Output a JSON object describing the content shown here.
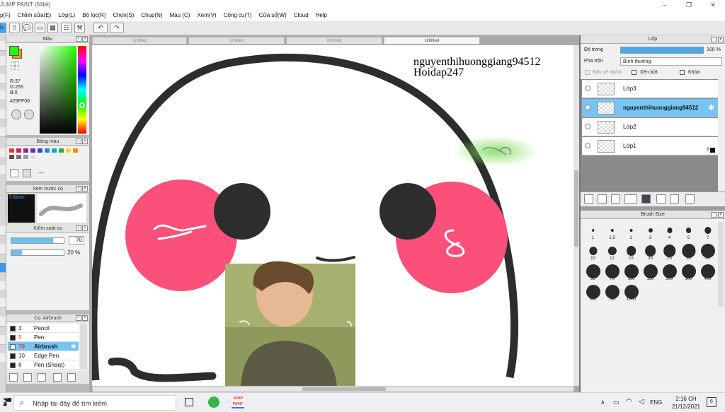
{
  "app": {
    "title": "JUMP PAINT (64bit)",
    "window_controls": [
      "–",
      "❐",
      "✕"
    ]
  },
  "menu": [
    "p(F)",
    "Chỉnh sửa(E)",
    "Lớp(L)",
    "Bộ lọc(R)",
    "Chọn(S)",
    "Chup(N)",
    "Màu (C)",
    "Xem(V)",
    "Công cụ(T)",
    "Cửa sổ(W)",
    "Cloud",
    "Help"
  ],
  "doc_tabs": [
    "Untitled",
    "Untitled",
    "Untitled",
    "Untitled"
  ],
  "left_panels": {
    "color": {
      "title": "Màu",
      "rgb": [
        "R:37",
        "G:255",
        "B:0"
      ],
      "hex": "#25FF00",
      "fg_color": "#25ff00",
      "bg_color": "#ff9900"
    },
    "palette": {
      "title": "Bảng màu",
      "swatches": [
        "#e53935",
        "#d81b60",
        "#8e24aa",
        "#5e35b1",
        "#3949ab",
        "#1e88e5",
        "#00acc1",
        "#43a047",
        "#fdd835",
        "#fb8c00",
        "#6d4c41",
        "#757575",
        "#9e9e9e",
        "#e0e0e0"
      ],
      "dash": "---"
    },
    "preview": {
      "title": "Xem trước cọ",
      "size": "5.08mm"
    },
    "brush_control": {
      "title": "Kiểm soát cọ",
      "size_value": "70",
      "opacity_value": "20 %",
      "size_fraction": 0.8,
      "opacity_fraction": 0.2
    },
    "brush_list": {
      "title": "Cọ: Airbrush",
      "items": [
        {
          "size": "3",
          "name": "Pencil",
          "selected": false
        },
        {
          "size": "5",
          "name": "Pen",
          "selected": false
        },
        {
          "size": "70",
          "name": "Airbrush",
          "selected": true
        },
        {
          "size": "10",
          "name": "Edge Pen",
          "selected": false
        },
        {
          "size": "8",
          "name": "Pen (Sharp)",
          "selected": false
        }
      ]
    }
  },
  "canvas": {
    "watermark_line1": "nguyenthihuonggiang94512",
    "watermark_line2": "Hoidap247"
  },
  "layers": {
    "title": "Lớp",
    "opacity_label": "Độ trong",
    "opacity_value": "100 %",
    "opacity_fraction": 1.0,
    "blend_label": "Pha trộn",
    "blend_value": "Bình thường",
    "opt_alpha": "Bảo vệ alpha",
    "opt_clip": "Xén bớt",
    "opt_lock": "Khóa",
    "items": [
      {
        "name": "Lớp3",
        "selected": false
      },
      {
        "name": "nguyenthihuonggiang94512",
        "selected": true
      },
      {
        "name": "Lớp2",
        "selected": false
      },
      {
        "name": "Lớp1",
        "selected": false
      }
    ],
    "corner_value": "8"
  },
  "brush_size": {
    "title": "Brush Size",
    "sizes": [
      "1",
      "1.5",
      "2",
      "3",
      "4",
      "5",
      "7",
      "10",
      "12",
      "15",
      "20",
      "25",
      "30",
      "40",
      "50",
      "70",
      "100",
      "150",
      "200",
      "300",
      "400",
      "500",
      "700",
      "1000"
    ]
  },
  "taskbar": {
    "search_placeholder": "Nhập tại đây để tìm kiếm",
    "lang": "ENG",
    "time": "2:16 CH",
    "date": "21/12/2021",
    "notifications": "6"
  }
}
